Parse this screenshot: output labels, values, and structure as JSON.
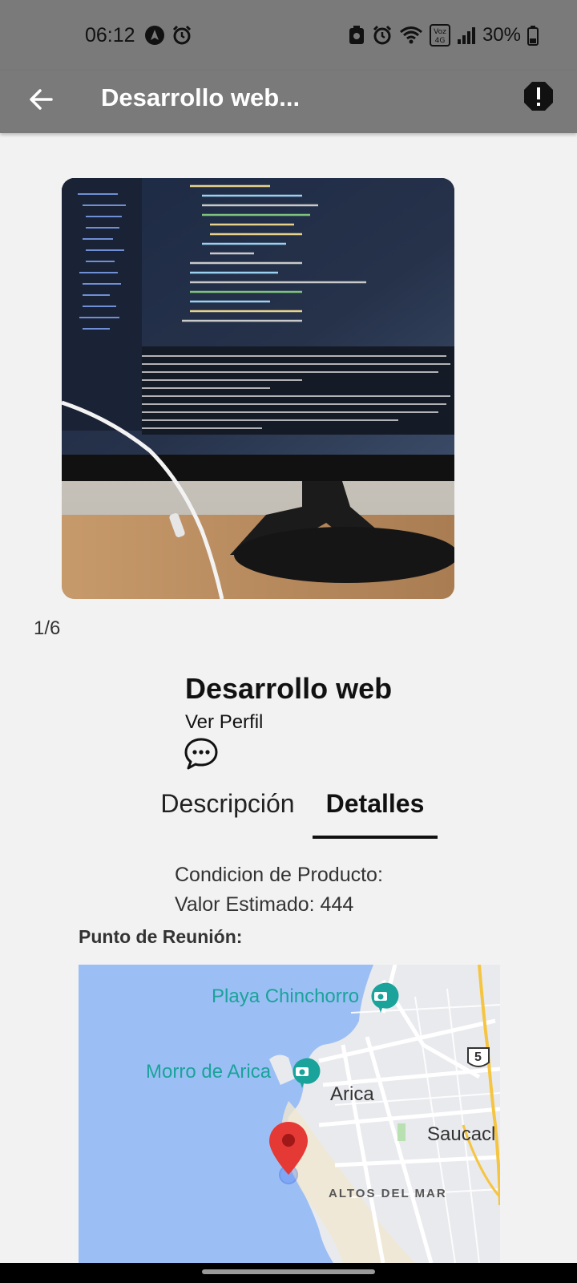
{
  "status_bar": {
    "time": "06:12",
    "battery": "30%",
    "network_badge": "Voz 4G"
  },
  "app_bar": {
    "title": "Desarrollo web...",
    "back_icon": "arrow-left-icon",
    "report_icon": "alert-octagon-icon"
  },
  "gallery": {
    "pager": "1/6",
    "current_index": 1,
    "total": 6
  },
  "product": {
    "title": "Desarrollo web",
    "profile_link": "Ver Perfil",
    "chat_icon": "chat-bubble-icon"
  },
  "tabs": [
    {
      "label": "Descripción",
      "selected": false
    },
    {
      "label": "Detalles",
      "selected": true
    }
  ],
  "details": {
    "condition_label": "Condicion de Producto:",
    "estimated_value": "Valor Estimado: 444",
    "meeting_point_label": "Punto de Reunión:"
  },
  "map": {
    "labels": {
      "playa": "Playa Chinchorro",
      "morro": "Morro de Arica",
      "city": "Arica",
      "saucache": "Saucacl",
      "altos": "ALTOS DEL MAR",
      "route": "5"
    },
    "colors": {
      "water": "#9bbff5",
      "land": "#e9eaee",
      "marker": "#e53935",
      "poi": "#1aa39a"
    }
  }
}
